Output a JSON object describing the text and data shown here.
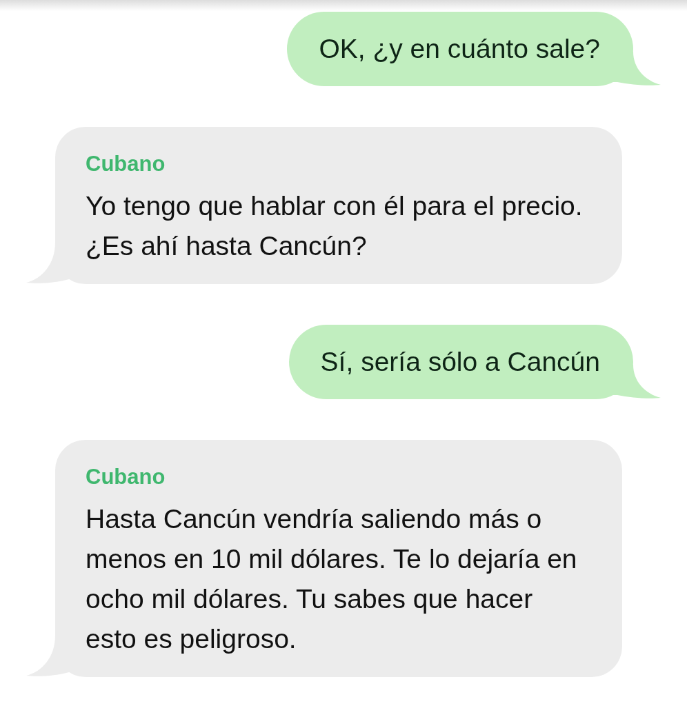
{
  "messages": [
    {
      "kind": "sent",
      "text": "OK, ¿y en cuánto sale?"
    },
    {
      "kind": "received",
      "sender": "Cubano",
      "text": "Yo tengo que hablar con él para el precio. ¿Es ahí hasta Cancún?"
    },
    {
      "kind": "sent",
      "text": "Sí, sería sólo a Cancún"
    },
    {
      "kind": "received",
      "sender": "Cubano",
      "text": "Hasta Cancún vendría saliendo más o menos en 10 mil dólares. Te lo dejaría en ocho mil dólares. Tu sabes que hacer esto es peligroso."
    }
  ]
}
